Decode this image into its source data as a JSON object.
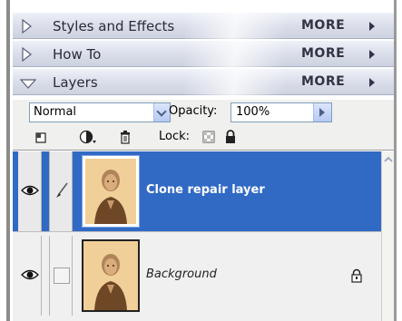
{
  "palettes": [
    {
      "title": "Styles and Effects",
      "more": "MORE",
      "expanded": false
    },
    {
      "title": "How To",
      "more": "MORE",
      "expanded": false
    },
    {
      "title": "Layers",
      "more": "MORE",
      "expanded": true
    }
  ],
  "options": {
    "blend_mode": "Normal",
    "opacity_label": "Opacity:",
    "opacity_value": "100%",
    "lock_label": "Lock:",
    "tools": [
      "new-layer-icon",
      "adjustment-layer-icon",
      "trash-icon",
      "lock-transparent-icon",
      "lock-all-icon"
    ]
  },
  "layers": [
    {
      "name": "Clone repair layer",
      "selected": true,
      "visible": true,
      "locked": false
    },
    {
      "name": "Background",
      "selected": false,
      "visible": true,
      "locked": true
    }
  ],
  "colors": {
    "selection": "#316ac5",
    "header_light": "#eef1f8",
    "header_dark": "#cdd2e0"
  }
}
